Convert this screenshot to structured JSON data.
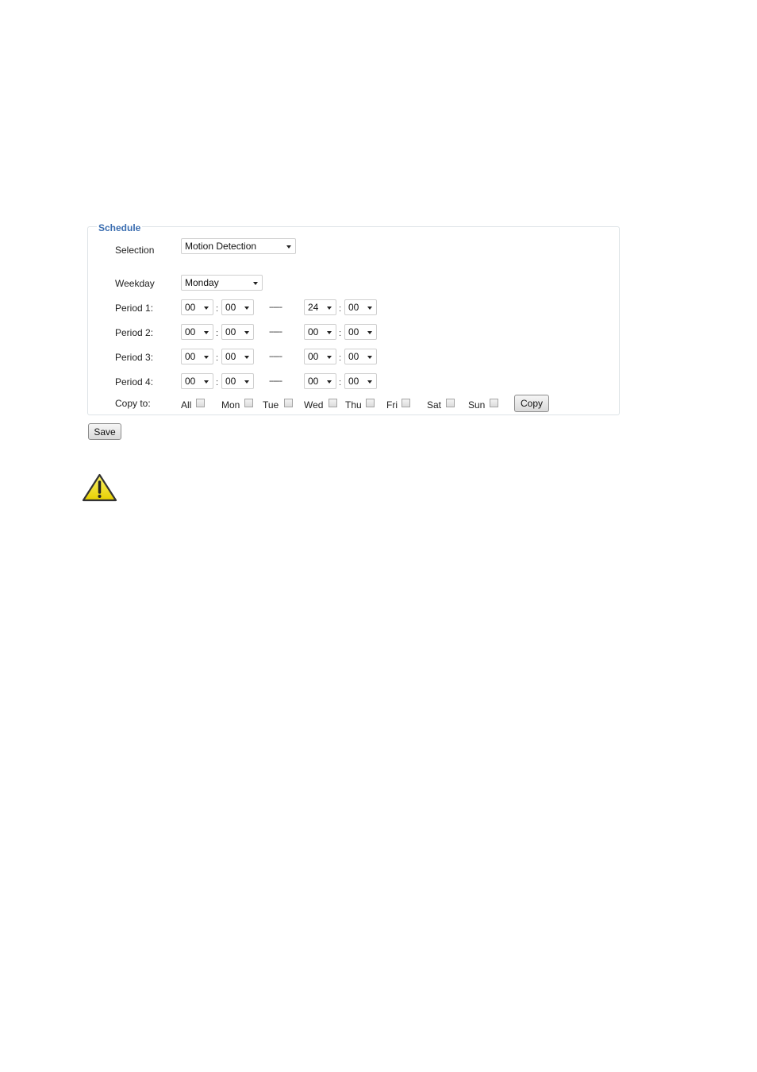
{
  "schedule": {
    "legend": "Schedule",
    "selection": {
      "label": "Selection",
      "value": "Motion Detection"
    },
    "weekday": {
      "label": "Weekday",
      "value": "Monday"
    },
    "separator": ":",
    "range_separator": "------",
    "periods": [
      {
        "label": "Period 1:",
        "start_hour": "00",
        "start_min": "00",
        "end_hour": "24",
        "end_min": "00"
      },
      {
        "label": "Period 2:",
        "start_hour": "00",
        "start_min": "00",
        "end_hour": "00",
        "end_min": "00"
      },
      {
        "label": "Period 3:",
        "start_hour": "00",
        "start_min": "00",
        "end_hour": "00",
        "end_min": "00"
      },
      {
        "label": "Period 4:",
        "start_hour": "00",
        "start_min": "00",
        "end_hour": "00",
        "end_min": "00"
      }
    ],
    "copy_to": {
      "label": "Copy to:",
      "days": [
        {
          "label": "All",
          "checked": false
        },
        {
          "label": "Mon",
          "checked": false
        },
        {
          "label": "Tue",
          "checked": false
        },
        {
          "label": "Wed",
          "checked": false
        },
        {
          "label": "Thu",
          "checked": false
        },
        {
          "label": "Fri",
          "checked": false
        },
        {
          "label": "Sat",
          "checked": false
        },
        {
          "label": "Sun",
          "checked": false
        }
      ],
      "copy_button": "Copy"
    }
  },
  "save_button": "Save",
  "icons": {
    "warning": "warning-triangle-icon"
  },
  "colors": {
    "legend": "#3a6db0",
    "warning_fill": "#f2e21a"
  }
}
